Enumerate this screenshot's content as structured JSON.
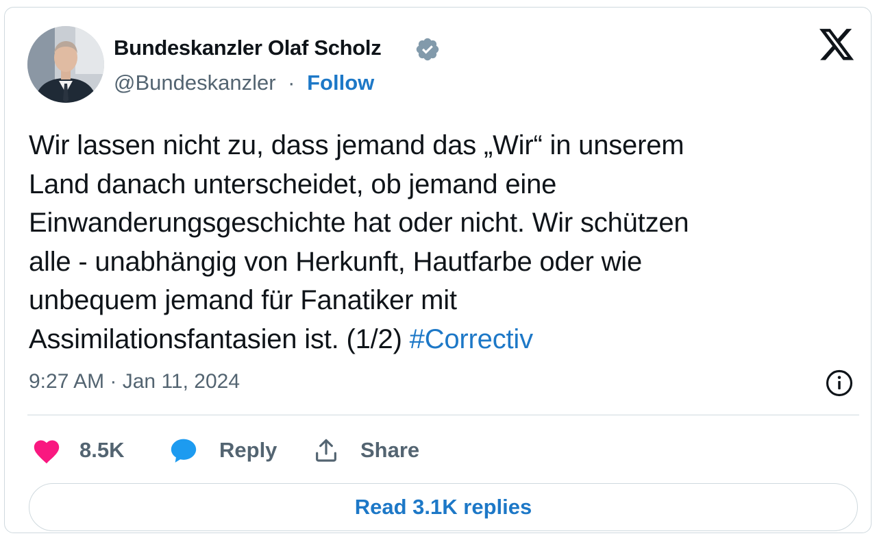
{
  "author": {
    "name": "Bundeskanzler Olaf Scholz",
    "handle": "@Bundeskanzler",
    "separator": "·",
    "follow_label": "Follow"
  },
  "tweet": {
    "lines": [
      "Wir lassen nicht zu, dass jemand das „Wir“ in unserem",
      "Land danach unterscheidet, ob jemand eine",
      "Einwanderungsgeschichte hat oder nicht. Wir schützen",
      "alle - unabhängig von Herkunft, Hautfarbe oder wie",
      "unbequem jemand für Fanatiker mit",
      "Assimilationsfantasien ist. (1/2) "
    ],
    "hashtag": "#Correctiv",
    "time": "9:27 AM",
    "separator": " · ",
    "date": "Jan 11, 2024"
  },
  "actions": {
    "like_count": "8.5K",
    "reply_label": "Reply",
    "share_label": "Share"
  },
  "read_replies_label": "Read 3.1K replies",
  "icons": {
    "verified": "verified-badge-icon",
    "logo": "x-logo-icon",
    "info": "info-icon",
    "like": "heart-icon",
    "reply": "speech-bubble-icon",
    "share": "share-icon"
  },
  "colors": {
    "link": "#1d78c7",
    "like": "#f91880",
    "reply": "#1d9bf0",
    "verified": "#829aab",
    "muted": "#536471",
    "text": "#0f1419"
  }
}
